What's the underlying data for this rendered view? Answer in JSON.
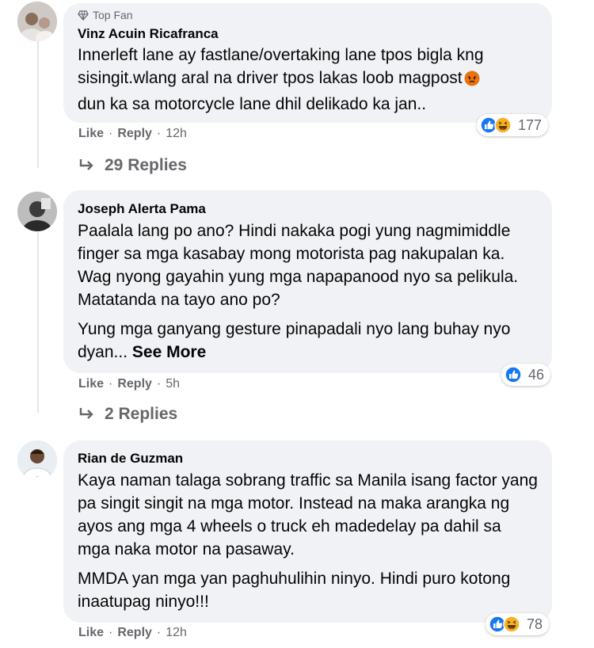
{
  "comments": [
    {
      "badge": "Top Fan",
      "author": "Vinz Acuin Ricafranca",
      "paragraphs": [
        "Innerleft lane ay fastlane/overtaking lane tpos bigla kng sisingit.wlang aral na driver tpos lakas loob magpost",
        "dun ka sa motorcycle lane dhil delikado ka jan.."
      ],
      "reaction_count": "177",
      "like": "Like",
      "reply": "Reply",
      "time": "12h",
      "replies": "29 Replies"
    },
    {
      "author": "Joseph Alerta Pama",
      "paragraphs": [
        "Paalala lang po ano? Hindi nakaka pogi yung nagmimiddle finger sa mga kasabay mong motorista pag nakupalan ka. Wag nyong gayahin yung mga napapanood nyo sa pelikula. Matatanda na tayo ano po?",
        "Yung mga ganyang gesture pinapadali nyo lang buhay nyo dyan..."
      ],
      "see_more": "See More",
      "reaction_count": "46",
      "like": "Like",
      "reply": "Reply",
      "time": "5h",
      "replies": "2 Replies"
    },
    {
      "author": "Rian de Guzman",
      "paragraphs": [
        "Kaya naman talaga sobrang traffic sa Manila isang factor yang pa singit singit na mga motor. Instead na maka arangka ng ayos ang mga 4 wheels o truck eh madedelay pa dahil sa mga naka motor na pasaway.",
        "MMDA yan mga yan paghuhulihin ninyo. Hindi puro kotong inaatupag ninyo!!!"
      ],
      "reaction_count": "78",
      "like": "Like",
      "reply": "Reply",
      "time": "12h"
    }
  ],
  "icons": {
    "top_fan": "diamond-badge-icon",
    "like_reaction": "like-reaction-icon",
    "haha_reaction": "haha-reaction-icon",
    "angry_emoji": "angry-emoji-icon",
    "reply_arrow": "reply-arrow-icon"
  },
  "colors": {
    "like_blue": "#1877f2",
    "haha_yellow": "#f7b125",
    "angry_orange": "#e9710f",
    "bubble_bg": "#f0f2f5",
    "meta_gray": "#65676b"
  },
  "separator": "·"
}
